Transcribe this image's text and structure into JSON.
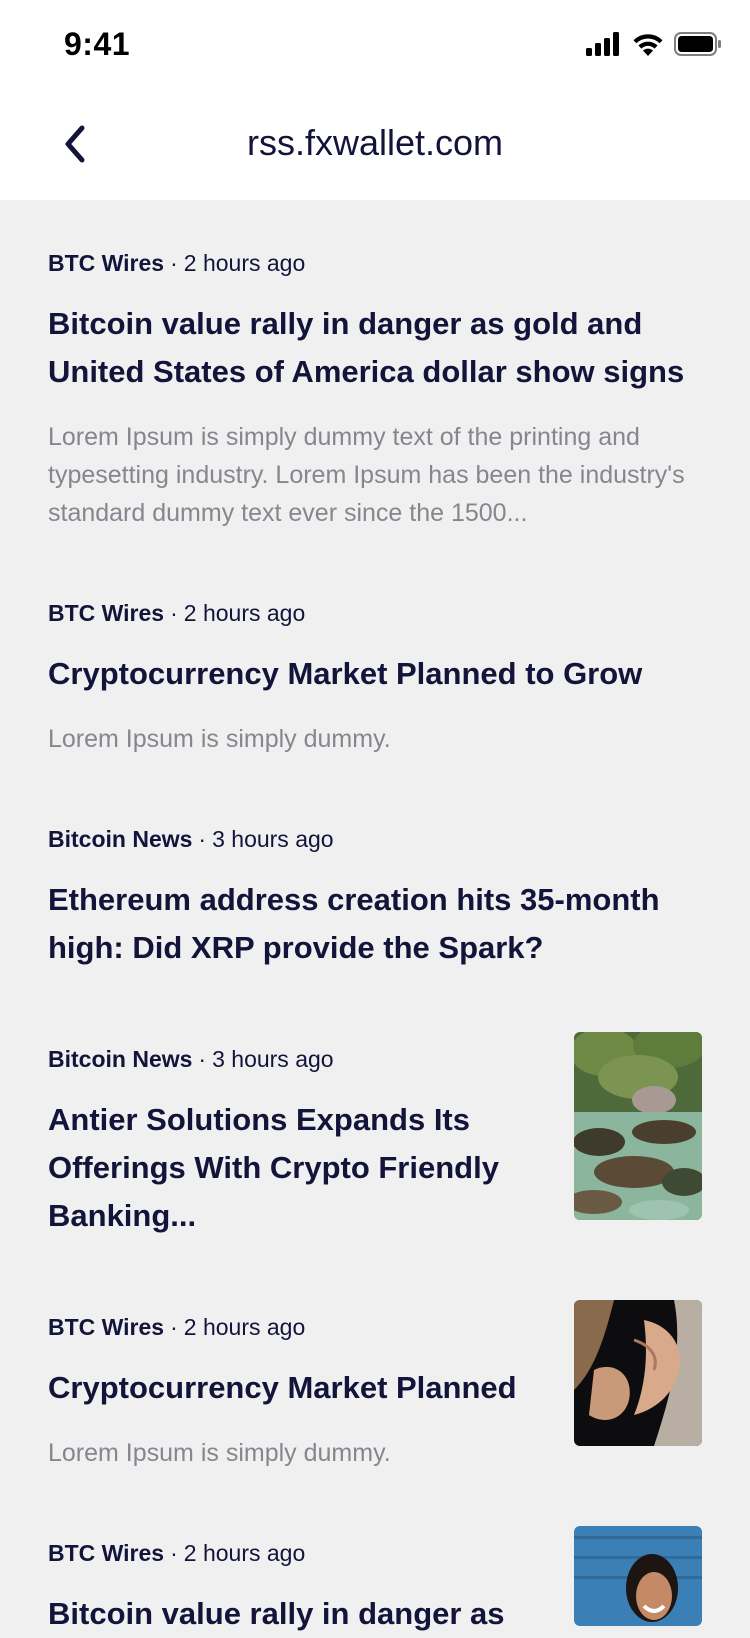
{
  "status_bar": {
    "time": "9:41",
    "icons": [
      "cellular-signal-icon",
      "wifi-icon",
      "battery-icon"
    ]
  },
  "nav": {
    "back_icon": "chevron-left-icon",
    "title": "rss.fxwallet.com"
  },
  "colors": {
    "background": "#f0f0f1",
    "header_background": "#ffffff",
    "text_primary": "#13143a",
    "text_secondary": "#86868f"
  },
  "articles": [
    {
      "source": "BTC Wires",
      "separator": "·",
      "time": "2 hours ago",
      "headline": "Bitcoin value rally in danger as gold and United States of America dollar show signs",
      "summary": "Lorem Ipsum is simply dummy text of the printing and typesetting industry. Lorem Ipsum has been the industry's standard dummy text ever since the 1500..."
    },
    {
      "source": "BTC Wires",
      "separator": "·",
      "time": "2 hours ago",
      "headline": "Cryptocurrency Market Planned to Grow",
      "summary": "Lorem Ipsum is simply dummy."
    },
    {
      "source": "Bitcoin News",
      "separator": "·",
      "time": "3 hours ago",
      "headline": "Ethereum address creation hits 35-month high: Did XRP provide the Spark?"
    },
    {
      "source": "Bitcoin News",
      "separator": "·",
      "time": "3 hours ago",
      "headline": "Antier Solutions Expands Its Offerings With Crypto Friendly Banking...",
      "thumbnail": "aerial-coastline-image"
    },
    {
      "source": "BTC Wires",
      "separator": "·",
      "time": "2 hours ago",
      "headline": "Cryptocurrency Market Planned",
      "summary": "Lorem Ipsum is simply dummy.",
      "thumbnail": "couple-embrace-image"
    },
    {
      "source": "BTC Wires",
      "separator": "·",
      "time": "2 hours ago",
      "headline": "Bitcoin value rally in danger as",
      "thumbnail": "smiling-person-image"
    }
  ]
}
